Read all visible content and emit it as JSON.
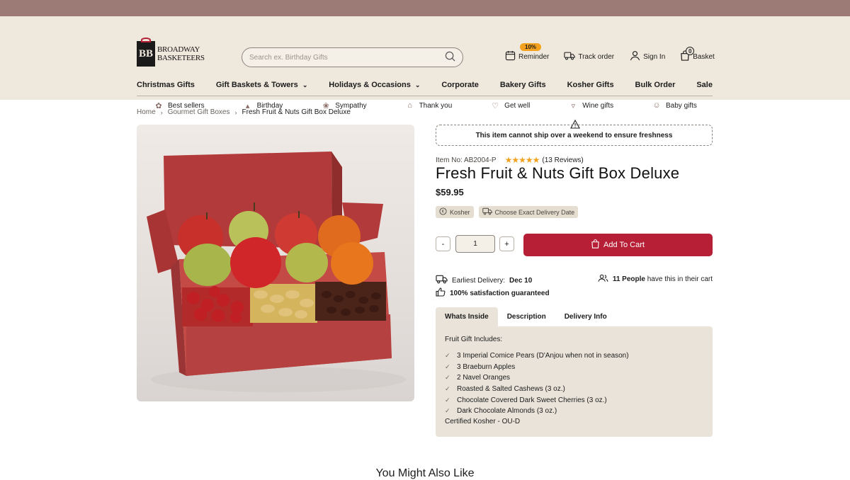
{
  "header": {
    "logo_line1": "BROADWAY",
    "logo_line2": "BASKETEERS",
    "search_placeholder": "Search ex. Birthday Gifts",
    "reminder_badge": "10%",
    "reminder_label": "Reminder",
    "track_label": "Track order",
    "signin_label": "Sign In",
    "basket_label": "Basket",
    "basket_count": "0"
  },
  "nav": {
    "items": [
      {
        "label": "Christmas Gifts",
        "dropdown": false
      },
      {
        "label": "Gift Baskets & Towers",
        "dropdown": true
      },
      {
        "label": "Holidays & Occasions",
        "dropdown": true
      },
      {
        "label": "Corporate",
        "dropdown": false
      },
      {
        "label": "Bakery Gifts",
        "dropdown": false
      },
      {
        "label": "Kosher Gifts",
        "dropdown": false
      },
      {
        "label": "Bulk Order",
        "dropdown": false
      },
      {
        "label": "Sale",
        "dropdown": false
      }
    ],
    "sub": [
      {
        "label": "Best sellers",
        "icon": "award-icon"
      },
      {
        "label": "Birthday",
        "icon": "cake-icon"
      },
      {
        "label": "Sympathy",
        "icon": "flowers-icon"
      },
      {
        "label": "Thank you",
        "icon": "gift-hand-icon"
      },
      {
        "label": "Get well",
        "icon": "heart-icon"
      },
      {
        "label": "Wine gifts",
        "icon": "wine-glass-icon"
      },
      {
        "label": "Baby gifts",
        "icon": "baby-icon"
      }
    ]
  },
  "breadcrumb": {
    "home": "Home",
    "category": "Gourmet Gift Boxes",
    "current": "Fresh Fruit & Nuts Gift Box Deluxe"
  },
  "product": {
    "notice": "This item cannot ship over a weekend to ensure freshness",
    "item_no": "Item No: AB2004-P",
    "rating_stars": "★★★★★",
    "rating": 5,
    "reviews": "(13 Reviews)",
    "title": "Fresh Fruit & Nuts Gift Box Deluxe",
    "price": "$59.95",
    "tag_kosher": "Kosher",
    "tag_delivery": "Choose Exact Delivery Date",
    "qty_minus": "-",
    "qty_value": "1",
    "qty_plus": "+",
    "add_to_cart": "Add To Cart",
    "earliest_label": "Earliest Delivery:",
    "earliest_date": "Dec 10",
    "people_count": "11 People",
    "people_text": "have this in their cart",
    "satisfaction": "100% satisfaction guaranteed"
  },
  "tabs": [
    {
      "label": "Whats Inside",
      "active": true
    },
    {
      "label": "Description",
      "active": false
    },
    {
      "label": "Delivery Info",
      "active": false
    }
  ],
  "inside": {
    "heading": "Fruit Gift Includes:",
    "items": [
      "3 Imperial Comice Pears (D'Anjou when not in season)",
      "3 Braeburn Apples",
      "2 Navel Oranges",
      "Roasted & Salted Cashews (3 oz.)",
      "Chocolate Covered Dark Sweet Cherries (3 oz.)",
      "Dark Chocolate Almonds (3 oz.)"
    ],
    "footer": "Certified Kosher - OU-D"
  },
  "also_like": "You Might Also Like",
  "colors": {
    "topbar": "#9c7b77",
    "header_bg": "#efe8dd",
    "accent_red": "#b61f36",
    "star": "#f0a21f",
    "badge": "#f4a21d"
  }
}
